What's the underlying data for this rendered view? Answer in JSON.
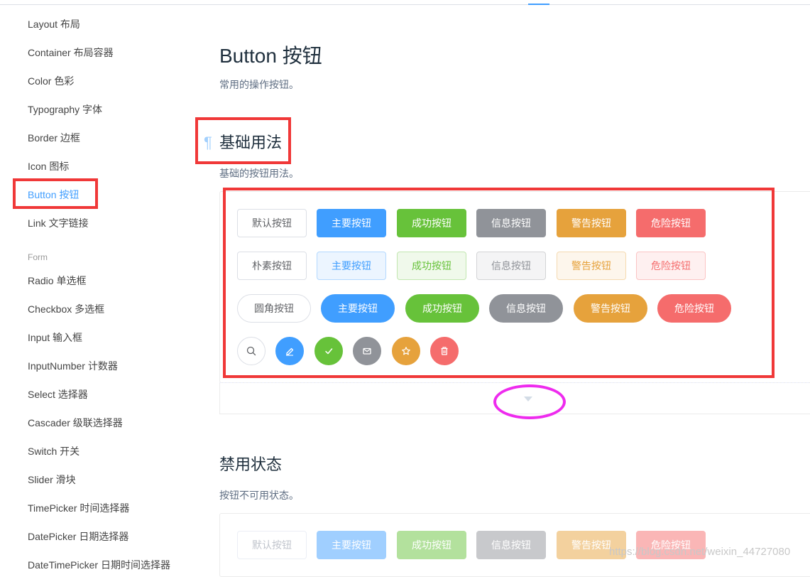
{
  "sidebar": {
    "items": [
      {
        "label": "Layout 布局"
      },
      {
        "label": "Container 布局容器"
      },
      {
        "label": "Color 色彩"
      },
      {
        "label": "Typography 字体"
      },
      {
        "label": "Border 边框"
      },
      {
        "label": "Icon 图标"
      },
      {
        "label": "Button 按钮"
      },
      {
        "label": "Link 文字链接"
      }
    ],
    "group": "Form",
    "form_items": [
      {
        "label": "Radio 单选框"
      },
      {
        "label": "Checkbox 多选框"
      },
      {
        "label": "Input 输入框"
      },
      {
        "label": "InputNumber 计数器"
      },
      {
        "label": "Select 选择器"
      },
      {
        "label": "Cascader 级联选择器"
      },
      {
        "label": "Switch 开关"
      },
      {
        "label": "Slider 滑块"
      },
      {
        "label": "TimePicker 时间选择器"
      },
      {
        "label": "DatePicker 日期选择器"
      },
      {
        "label": "DateTimePicker 日期时间选择器"
      }
    ]
  },
  "main": {
    "title": "Button 按钮",
    "desc": "常用的操作按钮。",
    "basic": {
      "pilcrow": "¶",
      "title": "基础用法",
      "desc": "基础的按钮用法。",
      "row1": [
        "默认按钮",
        "主要按钮",
        "成功按钮",
        "信息按钮",
        "警告按钮",
        "危险按钮"
      ],
      "row2": [
        "朴素按钮",
        "主要按钮",
        "成功按钮",
        "信息按钮",
        "警告按钮",
        "危险按钮"
      ],
      "row3": [
        "圆角按钮",
        "主要按钮",
        "成功按钮",
        "信息按钮",
        "警告按钮",
        "危险按钮"
      ],
      "row4_icons": [
        "search-icon",
        "edit-icon",
        "check-icon",
        "message-icon",
        "star-icon",
        "delete-icon"
      ]
    },
    "disabled": {
      "title": "禁用状态",
      "desc": "按钮不可用状态。",
      "row1": [
        "默认按钮",
        "主要按钮",
        "成功按钮",
        "信息按钮",
        "警告按钮",
        "危险按钮"
      ]
    }
  },
  "watermark": "https://blog.csdn.net/weixin_44727080",
  "colors": {
    "primary": "#409eff",
    "success": "#67c23a",
    "info": "#909399",
    "warning": "#e6a23c",
    "danger": "#f56c6c",
    "annotation_red": "#f03838",
    "annotation_pink": "#ee2bee"
  }
}
